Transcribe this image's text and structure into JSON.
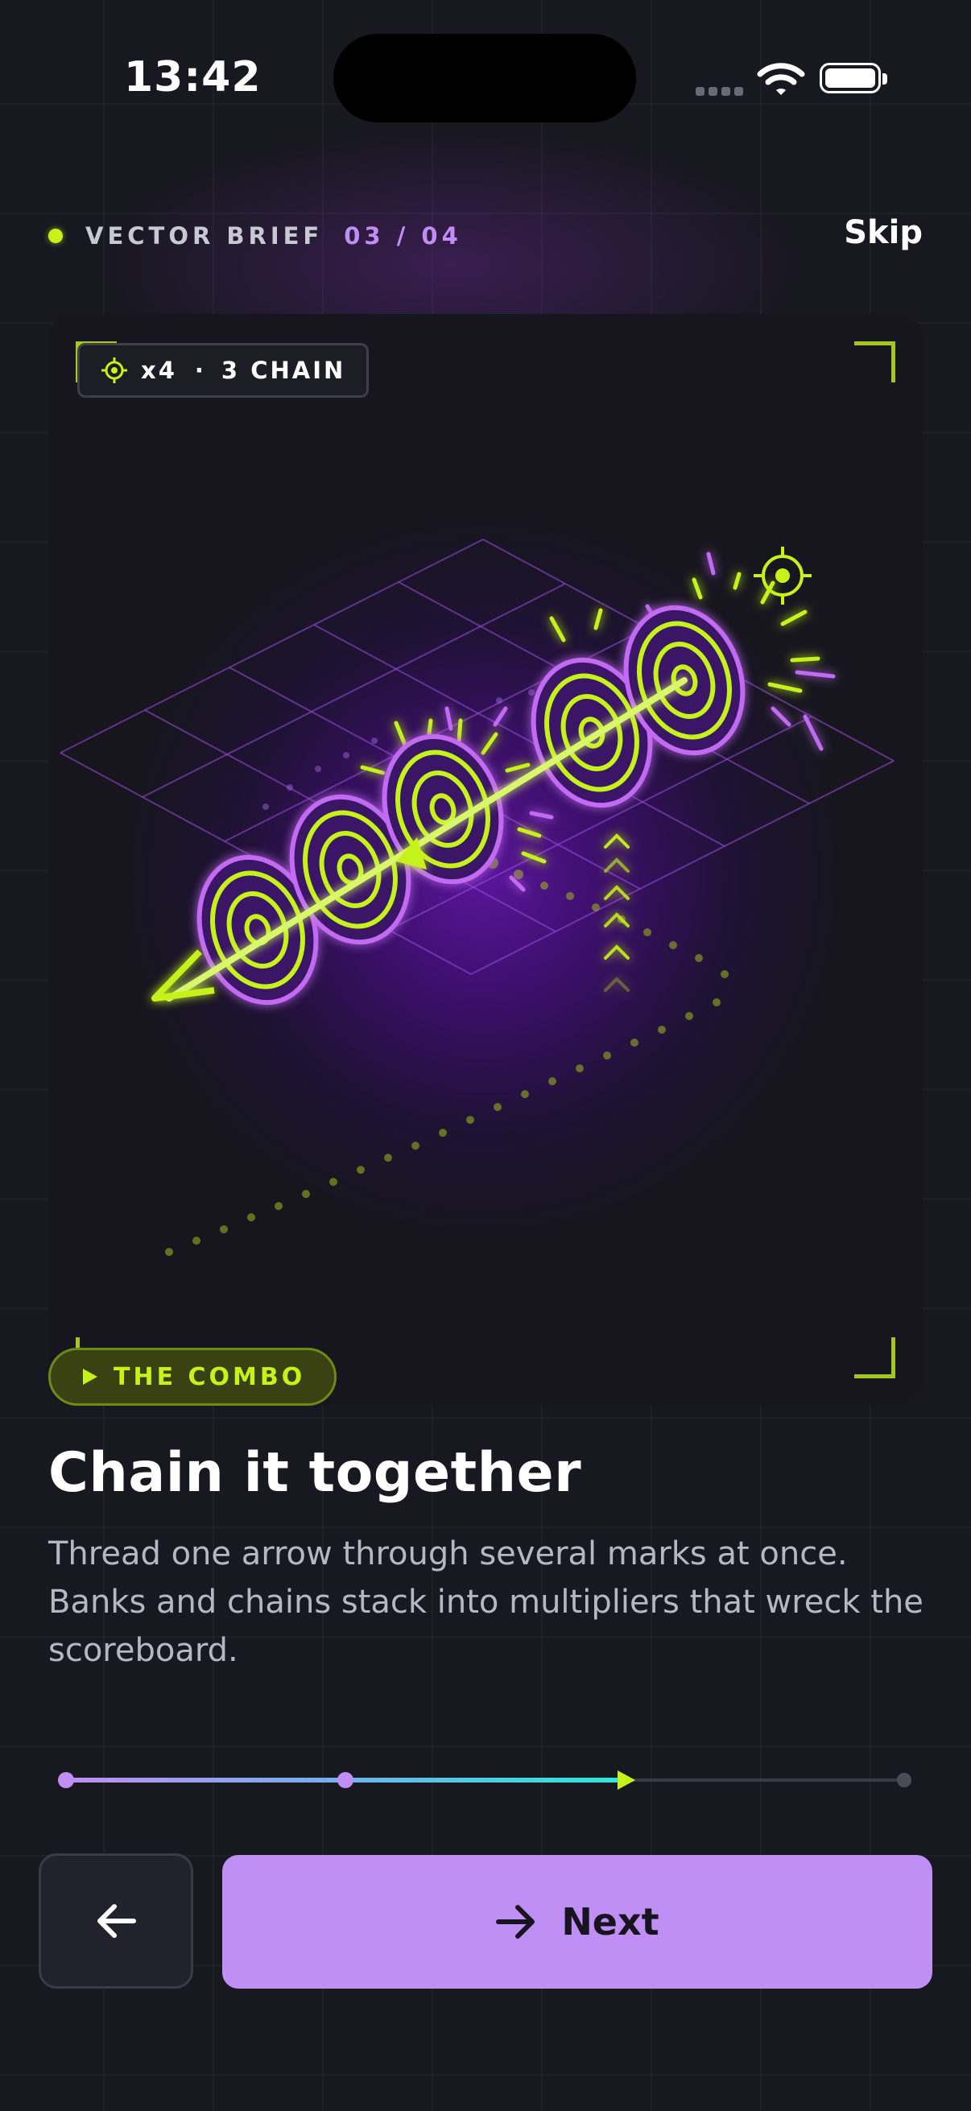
{
  "status_bar": {
    "time": "13:42"
  },
  "header": {
    "section_label": "VECTOR BRIEF",
    "step": "03 / 04",
    "skip_label": "Skip"
  },
  "card": {
    "hud": {
      "multiplier": "x4",
      "separator": "·",
      "chain": "3 CHAIN"
    },
    "illustration": "arrow threading five neon targets on an isometric grid"
  },
  "tag": {
    "label": "THE COMBO"
  },
  "headline": "Chain it together",
  "body": "Thread one arrow through several marks at once. Banks and chains stack into multipliers that wreck the scoreboard.",
  "progress": {
    "current_step": 3,
    "total_steps": 4
  },
  "buttons": {
    "back_icon": "arrow-left-icon",
    "next_icon": "arrow-right-icon",
    "next_label": "Next"
  },
  "colors": {
    "background": "#181820",
    "accent_lime": "#c6f21a",
    "accent_purple": "#bf8ff5",
    "accent_cyan": "#2ee6d8",
    "text_muted": "#b7b7c3"
  }
}
